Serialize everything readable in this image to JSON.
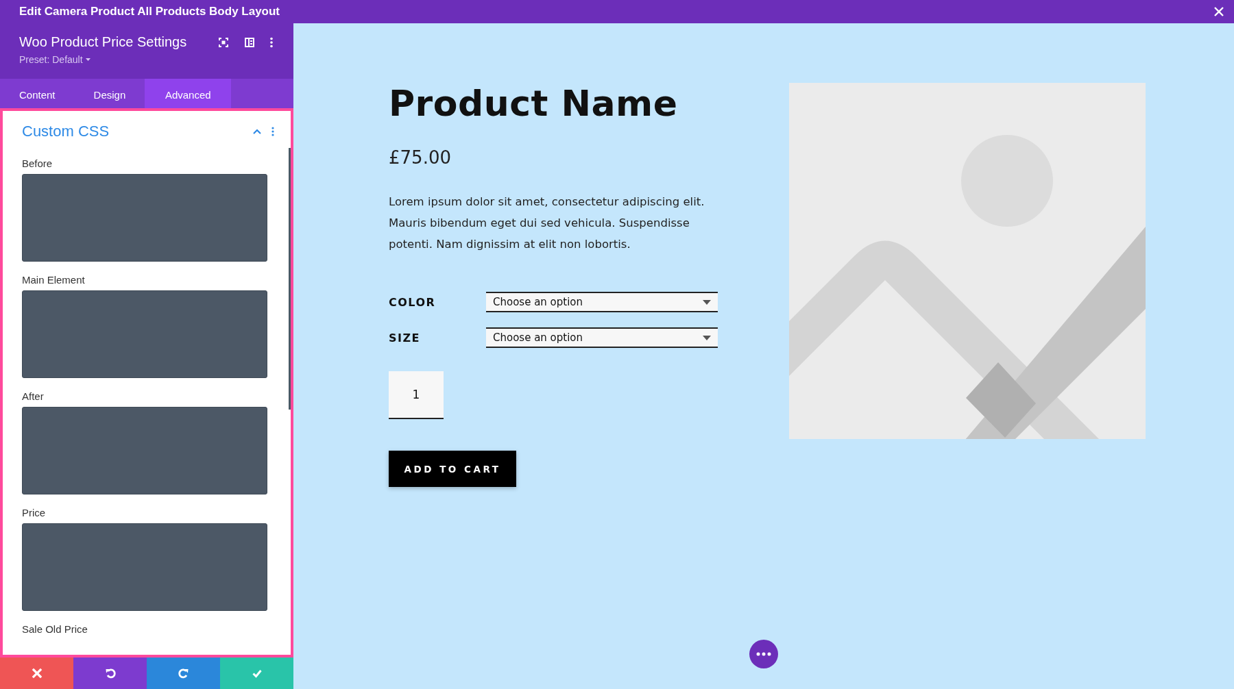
{
  "window": {
    "title": "Edit Camera Product All Products Body Layout"
  },
  "panel": {
    "title": "Woo Product Price Settings",
    "preset": "Preset: Default",
    "tabs": [
      {
        "label": "Content",
        "selected": false
      },
      {
        "label": "Design",
        "selected": false
      },
      {
        "label": "Advanced",
        "selected": true
      }
    ],
    "section": {
      "title": "Custom CSS",
      "expanded": true
    },
    "fields": [
      {
        "label": "Before",
        "kind": "textarea"
      },
      {
        "label": "Main Element",
        "kind": "textarea"
      },
      {
        "label": "After",
        "kind": "textarea"
      },
      {
        "label": "Price",
        "kind": "textarea"
      },
      {
        "label": "Sale Old Price",
        "kind": "label"
      }
    ],
    "actions": [
      {
        "kind": "cancel"
      },
      {
        "kind": "undo"
      },
      {
        "kind": "redo"
      },
      {
        "kind": "save"
      }
    ]
  },
  "product": {
    "name": "Product Name",
    "price": "£75.00",
    "description": "Lorem ipsum dolor sit amet, consectetur adipiscing elit. Mauris bibendum eget dui sed vehicula. Suspendisse potenti. Nam dignissim at elit non lobortis.",
    "attributes": [
      {
        "label": "COLOR",
        "value": "Choose an option"
      },
      {
        "label": "SIZE",
        "value": "Choose an option"
      }
    ],
    "quantity": "1",
    "button": "ADD TO CART"
  }
}
